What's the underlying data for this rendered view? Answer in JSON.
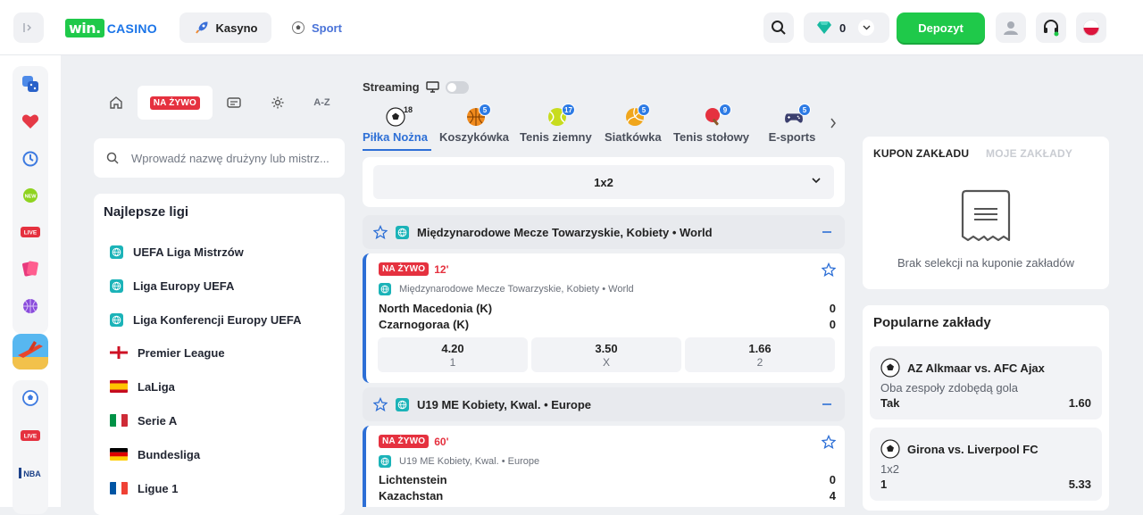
{
  "header": {
    "logo_win": "win.",
    "logo_casino": "CASINO",
    "nav_kasyno": "Kasyno",
    "nav_sport": "Sport",
    "balance": "0",
    "deposit": "Depozyt"
  },
  "rail": {
    "icons": [
      "dice-icon",
      "heart-icon",
      "history-icon",
      "new-badge-icon",
      "live-badge-icon",
      "cards-icon",
      "basketball-icon",
      "game-thumbnail-icon",
      "football-icon",
      "live-badge-icon",
      "nba-icon"
    ],
    "new_label": "NEW",
    "live_label": "LIVE",
    "nba_label": "NBA"
  },
  "left": {
    "tabs": {
      "live": "NA ŻYWO",
      "az": "A-Z"
    },
    "search_placeholder": "Wprowadź nazwę drużyny lub mistrz...",
    "leagues_title": "Najlepsze ligi",
    "leagues": [
      {
        "name": "UEFA Liga Mistrzów",
        "flag": "globe"
      },
      {
        "name": "Liga Europy UEFA",
        "flag": "globe"
      },
      {
        "name": "Liga Konferencji Europy UEFA",
        "flag": "globe"
      },
      {
        "name": "Premier League",
        "flag": "england"
      },
      {
        "name": "LaLiga",
        "flag": "spain"
      },
      {
        "name": "Serie A",
        "flag": "italy"
      },
      {
        "name": "Bundesliga",
        "flag": "germany"
      },
      {
        "name": "Ligue 1",
        "flag": "france"
      }
    ]
  },
  "center": {
    "streaming_label": "Streaming",
    "sports": [
      {
        "name": "Piłka Nożna",
        "count": "18",
        "active": true
      },
      {
        "name": "Koszykówka",
        "count": "5"
      },
      {
        "name": "Tenis ziemny",
        "count": "17"
      },
      {
        "name": "Siatkówka",
        "count": "5"
      },
      {
        "name": "Tenis stołowy",
        "count": "9"
      },
      {
        "name": "E-sports",
        "count": "5"
      }
    ],
    "market_label": "1x2",
    "competitions": [
      {
        "title": "Międzynarodowe Mecze Towarzyskie, Kobiety • World",
        "event": {
          "live": "NA ŻYWO",
          "minute": "12'",
          "league": "Międzynarodowe Mecze Towarzyskie, Kobiety • World",
          "home": "North Macedonia (K)",
          "away": "Czarnogoraa (K)",
          "home_score": "0",
          "away_score": "0",
          "odds": [
            {
              "value": "4.20",
              "label": "1"
            },
            {
              "value": "3.50",
              "label": "X"
            },
            {
              "value": "1.66",
              "label": "2"
            }
          ]
        }
      },
      {
        "title": "U19 ME Kobiety, Kwal. • Europe",
        "event": {
          "live": "NA ŻYWO",
          "minute": "60'",
          "league": "U19 ME Kobiety, Kwal. • Europe",
          "home": "Lichtenstein",
          "away": "Kazachstan",
          "home_score": "0",
          "away_score": "4"
        }
      }
    ]
  },
  "right": {
    "coupon_tab": "KUPON ZAKŁADU",
    "my_bets_tab": "MOJE ZAKŁADY",
    "coupon_empty": "Brak selekcji na kuponie zakładów",
    "popular_title": "Popularne zakłady",
    "popular": [
      {
        "match": "AZ Alkmaar vs. AFC Ajax",
        "market": "Oba zespoły zdobędą gola",
        "selection": "Tak",
        "odd": "1.60"
      },
      {
        "match": "Girona vs. Liverpool FC",
        "market": "1x2",
        "selection": "1",
        "odd": "5.33"
      }
    ]
  },
  "colors": {
    "accent_blue": "#2d6fd6",
    "brand_green": "#1fc94a",
    "live_red": "#e5313f"
  }
}
